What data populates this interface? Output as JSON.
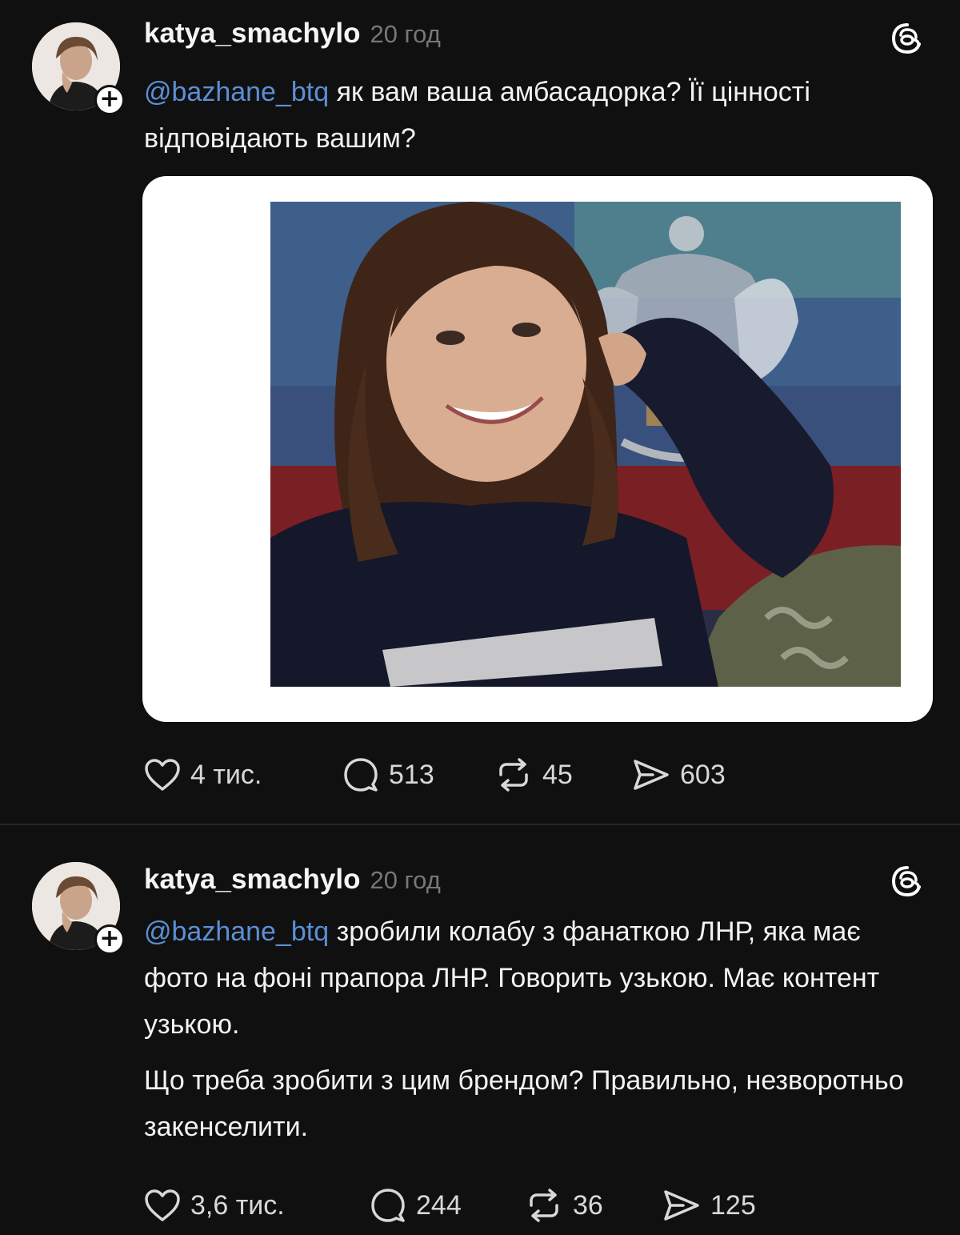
{
  "posts": [
    {
      "username": "katya_smachylo",
      "time": "20 год",
      "mention": "@bazhane_btq",
      "text": " як вам ваша амбасадорка? Її цінності відповідають вашим?",
      "has_image": true,
      "likes": "4 тис.",
      "replies": "513",
      "reposts": "45",
      "shares": "603"
    },
    {
      "username": "katya_smachylo",
      "time": "20 год",
      "mention": "@bazhane_btq",
      "text": " зробили колабу з фанаткою ЛНР, яка має фото на фоні прапора ЛНР. Говорить узькою. Має контент узькою.",
      "text2": "Що треба зробити з цим брендом? Правильно, незворотньо закенселити.",
      "likes": "3,6 тис.",
      "replies": "244",
      "reposts": "36",
      "shares": "125"
    }
  ],
  "icons": {
    "follow": "+",
    "threads": "threads-logo-icon",
    "like": "heart-icon",
    "reply": "comment-icon",
    "repost": "repost-icon",
    "share": "send-icon"
  },
  "colors": {
    "background": "#101010",
    "mention": "#5b8fd6",
    "muted": "#777777"
  }
}
